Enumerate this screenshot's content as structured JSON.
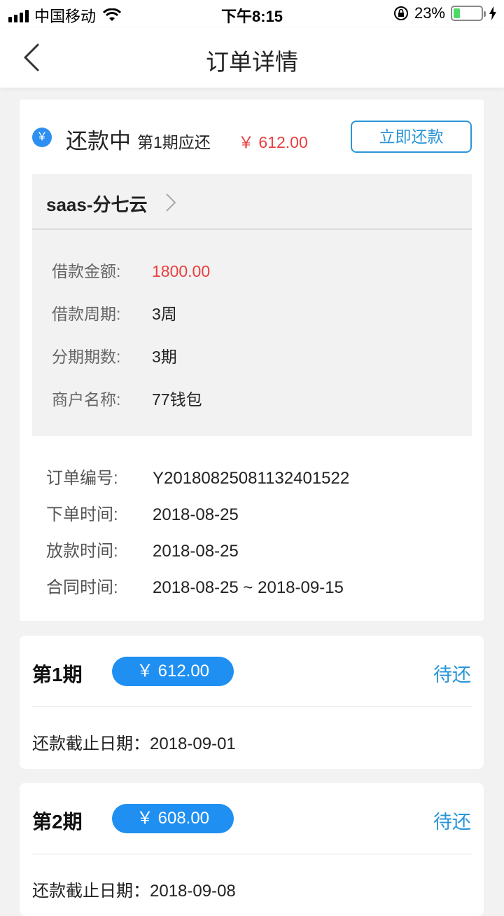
{
  "status_bar": {
    "carrier": "中国移动",
    "time": "下午8:15",
    "battery": "23%",
    "battery_level": 0.23
  },
  "nav": {
    "title": "订单详情"
  },
  "order": {
    "status": "还款中",
    "period_label": "第1期应还",
    "due_amount": "￥ 612.00",
    "pay_button": "立即还款",
    "merchant_title": "saas-分七云",
    "details": [
      {
        "label": "借款金额:",
        "value": "1800.00"
      },
      {
        "label": "借款周期:",
        "value": "3周"
      },
      {
        "label": "分期期数:",
        "value": "3期"
      },
      {
        "label": "商户名称:",
        "value": "77钱包"
      }
    ],
    "meta": [
      {
        "label": "订单编号:",
        "value": "Y2018082508113240152 2"
      },
      {
        "label": "下单时间:",
        "value": "2018-08-25"
      },
      {
        "label": "放款时间:",
        "value": "2018-08-25"
      },
      {
        "label": "合同时间:",
        "value": "2018-08-25 ~ 2018-09-15"
      }
    ]
  },
  "periods": [
    {
      "name": "第1期",
      "amount": "￥ 612.00",
      "status": "待还",
      "deadline": "还款截止日期：2018-09-01"
    },
    {
      "name": "第2期",
      "amount": "￥ 608.00",
      "status": "待还",
      "deadline": "还款截止日期：2018-09-08"
    }
  ],
  "colors": {
    "accent_blue": "#2a95d8",
    "pill_blue": "#1f8ff2",
    "amount_red": "#e8403f"
  }
}
